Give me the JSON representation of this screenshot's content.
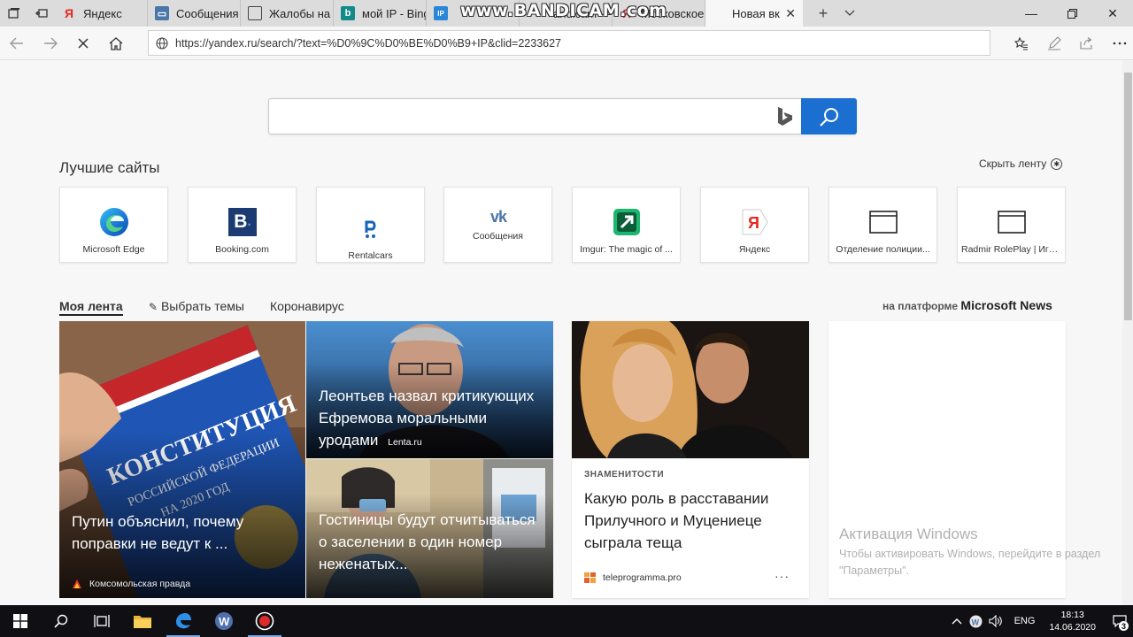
{
  "tabs": [
    {
      "title": "Яндекс",
      "icon": "yandex-icon"
    },
    {
      "title": "Сообщения",
      "icon": "vk-icon"
    },
    {
      "title": "Жалобы на а",
      "icon": "page-icon"
    },
    {
      "title": "мой IP - Bing",
      "icon": "bing-icon"
    },
    {
      "title": "IP",
      "icon": "ip-icon"
    },
    {
      "title": "andicam —",
      "icon": "page-icon"
    },
    {
      "title": "Московское",
      "icon": "yandex-icon"
    },
    {
      "title": "Новая вк",
      "icon": "new-tab-icon",
      "active": true
    }
  ],
  "watermark": "www.BANDICAM.com",
  "address_bar": {
    "url": "https://yandex.ru/search/?text=%D0%9C%D0%BE%D0%B9+IP&clid=2233627"
  },
  "search": {
    "value": "",
    "placeholder": ""
  },
  "top_sites": {
    "title": "Лучшие сайты",
    "hide_feed_label": "Скрыть ленту",
    "sites": [
      {
        "label": "Microsoft Edge",
        "icon": "edge-icon"
      },
      {
        "label": "Booking.com",
        "icon": "booking-icon"
      },
      {
        "label": "Rentalcars",
        "icon": "rentalcars-icon"
      },
      {
        "label": "Сообщения",
        "icon": "vk-icon"
      },
      {
        "label": "Imgur: The magic of ...",
        "icon": "imgur-icon"
      },
      {
        "label": "Яндекс",
        "icon": "yandex-icon"
      },
      {
        "label": "Отделение полиции...",
        "icon": "window-icon"
      },
      {
        "label": "Radmir RolePlay | Игр...",
        "icon": "window-icon"
      }
    ]
  },
  "feed_nav": {
    "my_feed": "Моя лента",
    "choose_topics": "Выбрать темы",
    "coronavirus": "Коронавирус",
    "platform_prefix": "на платформе",
    "platform_brand": "Microsoft News"
  },
  "news": {
    "putin": {
      "headline": "Путин объяснил, почему поправки не ведут к ...",
      "source": "Комсомольская правда"
    },
    "leontiev": {
      "headline": "Леонтьев назвал критикующих Ефремова моральными уродами",
      "source": "Lenta.ru"
    },
    "hotels": {
      "headline": "Гостиницы будут отчитываться о заселении в один номер неженатых..."
    },
    "celeb": {
      "category": "ЗНАМЕНИТОСТИ",
      "headline": "Какую роль в расставании Прилучного и Муцениеце сыграла теща",
      "source": "teleprogramma.pro",
      "more": "···"
    }
  },
  "activation": {
    "title": "Активация Windows",
    "text": "Чтобы активировать Windows, перейдите в раздел \"Параметры\"."
  },
  "taskbar": {
    "lang": "ENG",
    "time": "18:13",
    "date": "14.06.2020",
    "notifications": "3"
  },
  "colors": {
    "accent": "#1a6fd1",
    "taskbar": "#101014",
    "tabstrip": "#dcdcdc"
  }
}
